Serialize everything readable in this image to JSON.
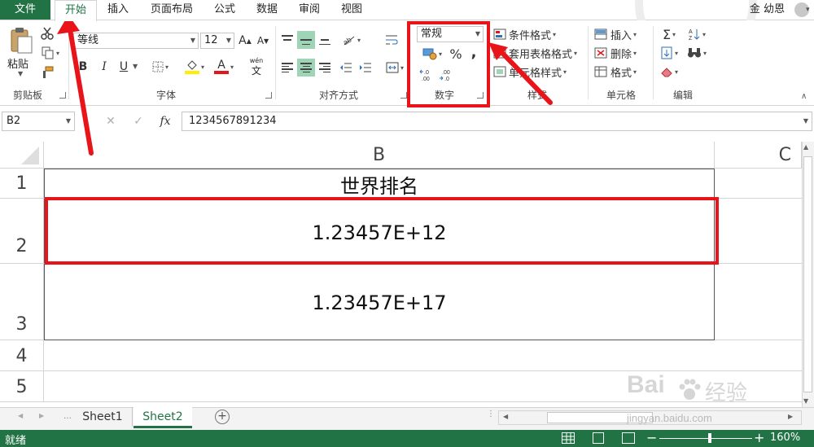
{
  "ribbon_tabs": {
    "file": "文件",
    "home": "开始",
    "insert": "插入",
    "page_layout": "页面布局",
    "formulas": "公式",
    "data": "数据",
    "review": "审阅",
    "view": "视图"
  },
  "user": {
    "name": "金 幼恩",
    "caret": "▾"
  },
  "clipboard": {
    "paste": "粘贴",
    "cut_icon": "scissors-icon",
    "copy_icon": "copy-icon",
    "painter_icon": "format-painter-icon",
    "group_label": "剪贴板"
  },
  "font": {
    "name": "等线",
    "size": "12",
    "grow": "A",
    "shrink": "A",
    "bold": "B",
    "italic": "I",
    "underline": "U",
    "color_letter": "A",
    "phonetic": "wén",
    "phonetic_char": "文",
    "group_label": "字体"
  },
  "alignment": {
    "group_label": "对齐方式"
  },
  "number": {
    "format": "常规",
    "percent": "%",
    "comma": ",",
    "group_label": "数字"
  },
  "styles": {
    "conditional": "条件格式",
    "table": "套用表格格式",
    "cell": "单元格样式",
    "group_label": "样式"
  },
  "cells": {
    "insert": "插入",
    "delete": "删除",
    "format": "格式",
    "group_label": "单元格"
  },
  "editing": {
    "sum": "Σ",
    "sort": "A Z",
    "group_label": "编辑"
  },
  "formula_bar": {
    "name_box": "B2",
    "cancel": "✕",
    "enter": "✓",
    "fx": "fx",
    "value": "1234567891234"
  },
  "grid": {
    "columns": [
      "B",
      "C"
    ],
    "rows": [
      "1",
      "2",
      "3",
      "4",
      "5"
    ],
    "cells": {
      "B1": "世界排名",
      "B2": "1.23457E+12",
      "B3": "1.23457E+17"
    }
  },
  "sheets": [
    "Sheet1",
    "Sheet2"
  ],
  "add_sheet": "+",
  "status": {
    "ready": "就绪",
    "zoom": "160%",
    "minus": "−",
    "plus": "+"
  },
  "watermark": {
    "brand": "Bai",
    "du": "经验",
    "url": "jingyan.baidu.com"
  },
  "colors": {
    "excel_green": "#217346",
    "annotation_red": "#e8141a"
  }
}
